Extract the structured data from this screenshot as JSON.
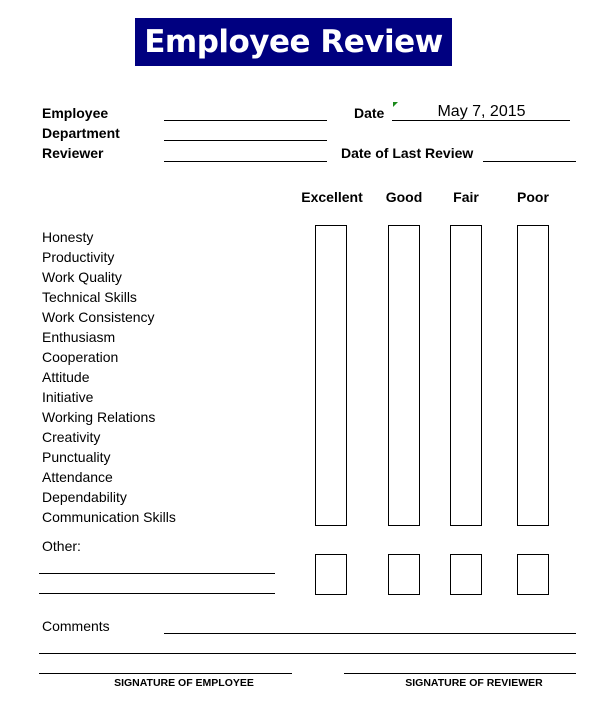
{
  "header": {
    "title": "Employee Review",
    "title_bg_color": "#000080"
  },
  "fields": {
    "employee_label": "Employee",
    "department_label": "Department",
    "reviewer_label": "Reviewer",
    "date_label": "Date",
    "date_value": "May 7, 2015",
    "last_review_label": "Date of Last Review",
    "employee_value": "",
    "department_value": "",
    "reviewer_value": "",
    "last_review_value": ""
  },
  "rating_columns": [
    "Excellent",
    "Good",
    "Fair",
    "Poor"
  ],
  "criteria": [
    "Honesty",
    "Productivity",
    "Work Quality",
    "Technical Skills",
    "Work Consistency",
    "Enthusiasm",
    "Cooperation",
    "Attitude",
    "Initiative",
    "Working Relations",
    "Creativity",
    "Punctuality",
    "Attendance",
    "Dependability",
    "Communication Skills"
  ],
  "other": {
    "label": "Other:",
    "rows": 2
  },
  "comments": {
    "label": "Comments"
  },
  "signatures": {
    "employee": "SIGNATURE OF EMPLOYEE",
    "reviewer": "SIGNATURE OF REVIEWER"
  }
}
